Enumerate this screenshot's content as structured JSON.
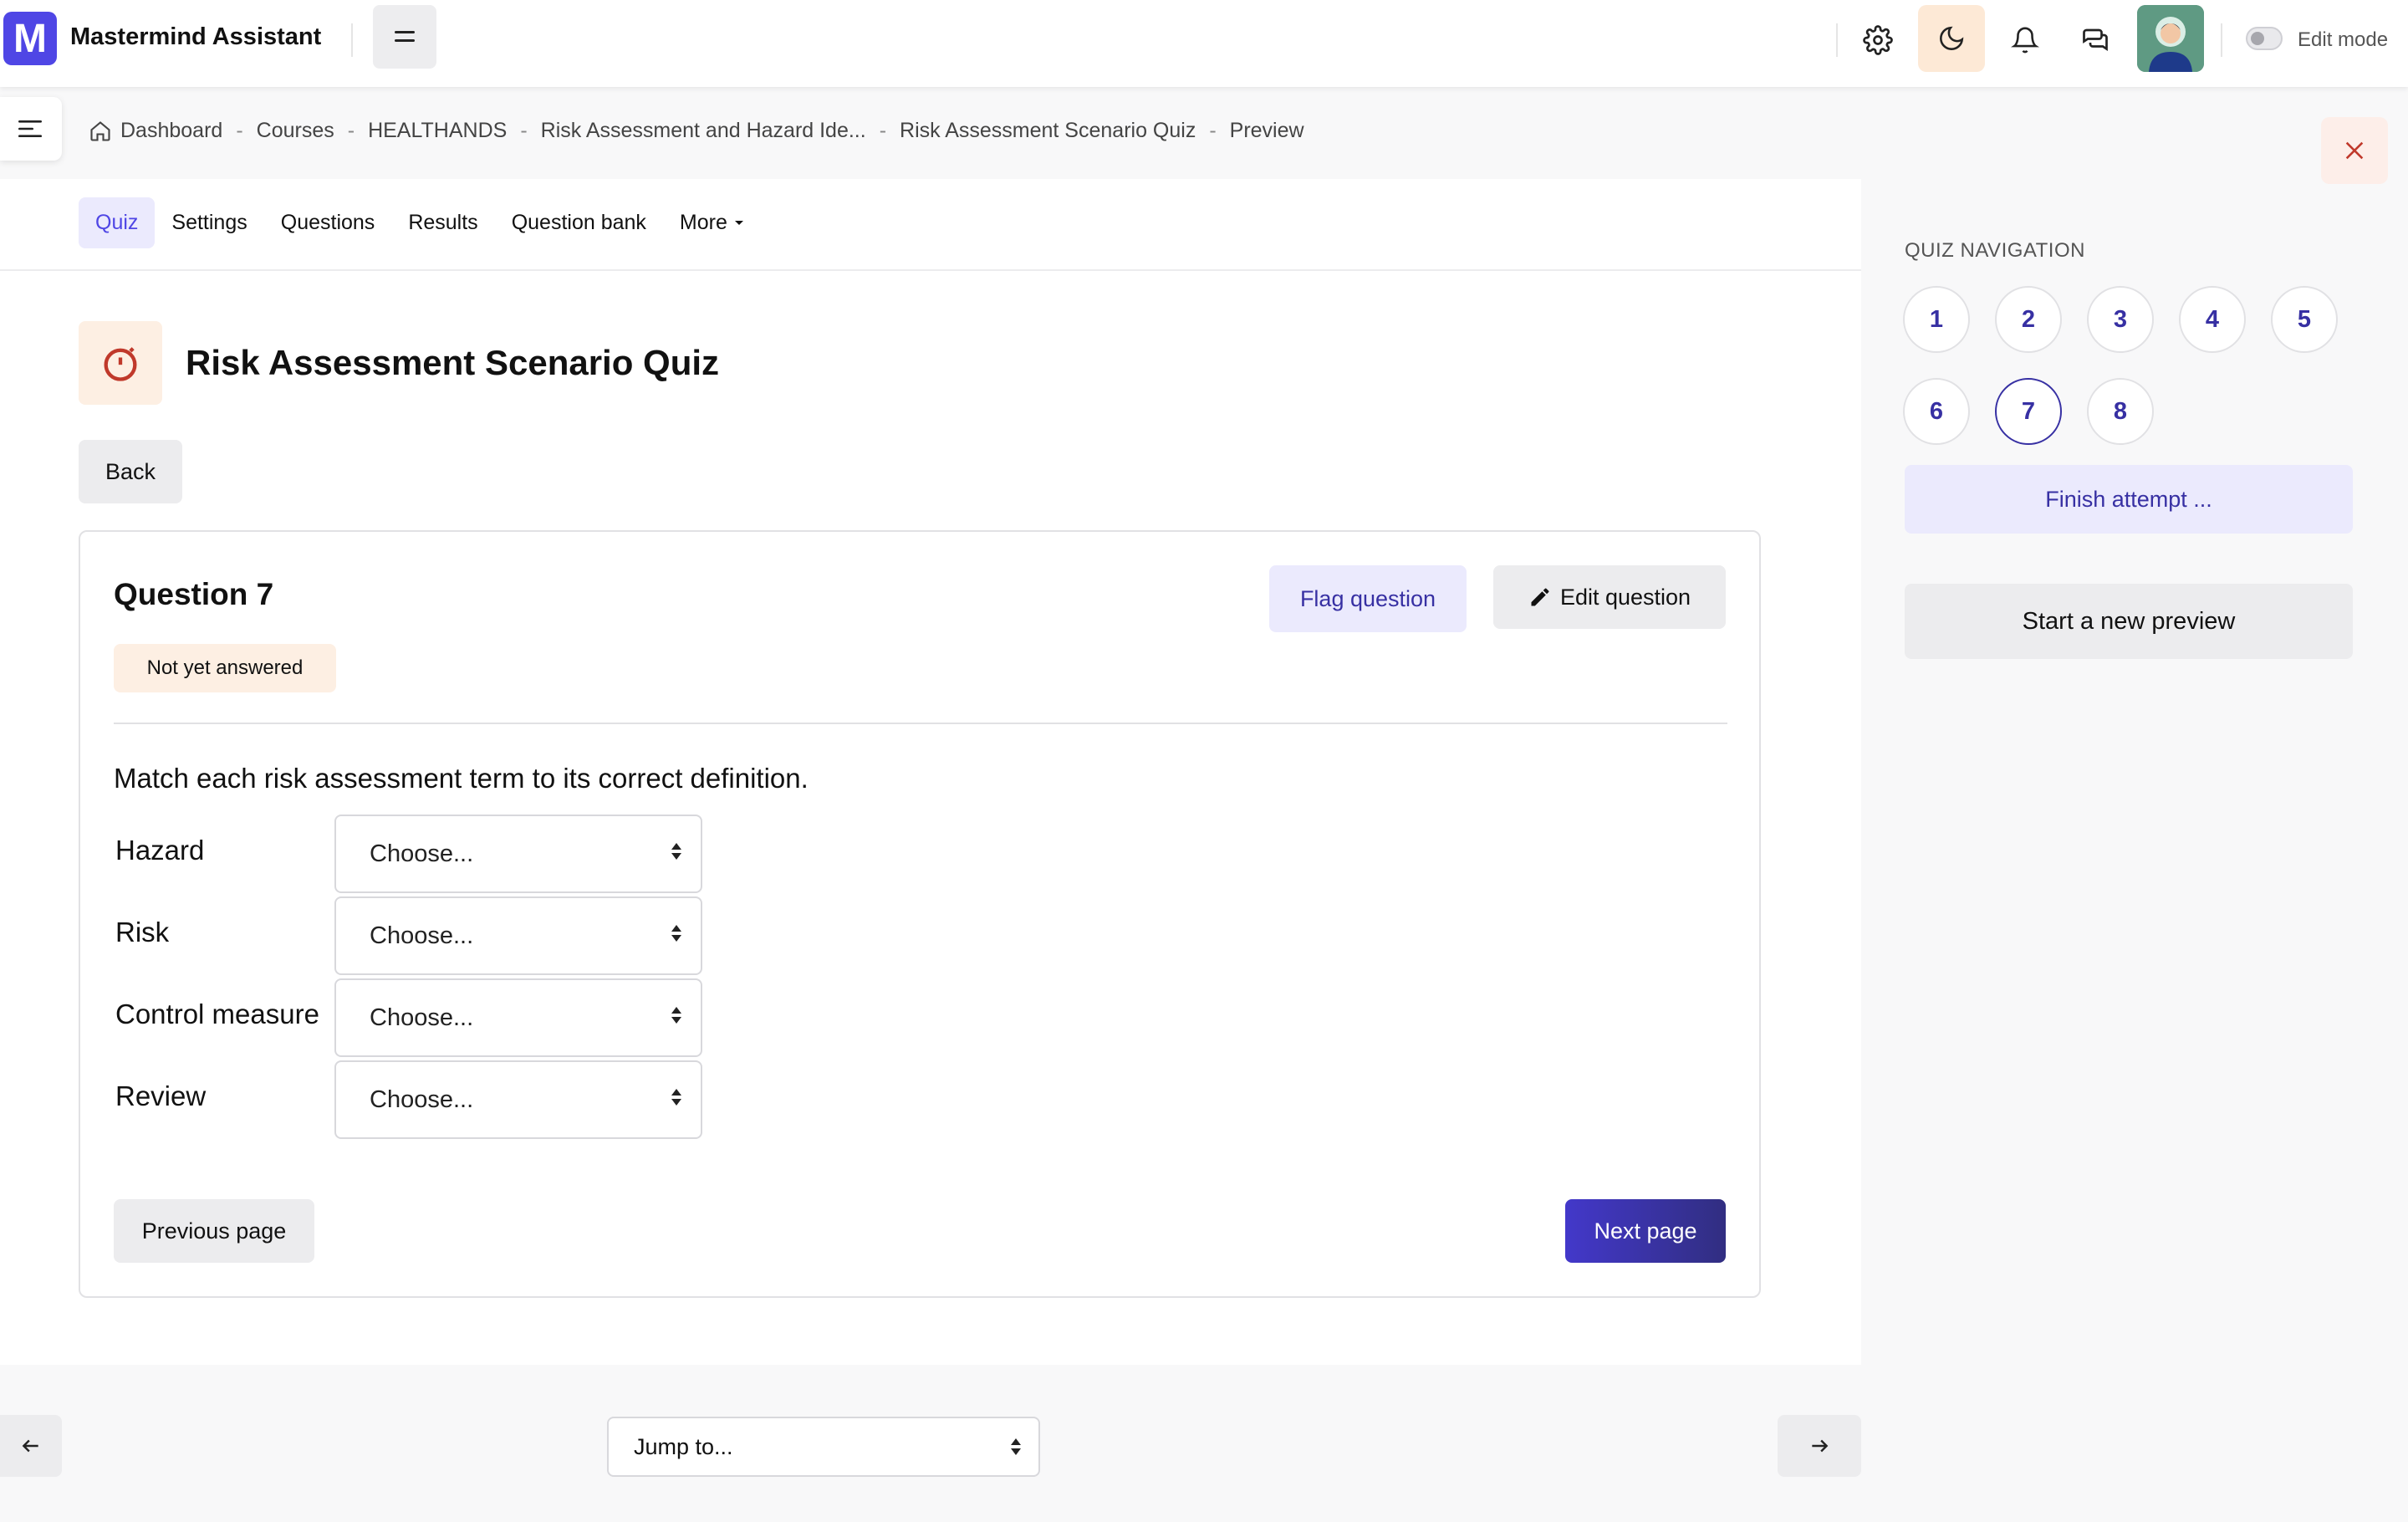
{
  "header": {
    "app_title": "Mastermind Assistant",
    "logo_letter": "M",
    "edit_mode_label": "Edit mode"
  },
  "breadcrumb": [
    "Dashboard",
    "Courses",
    "HEALTHANDS",
    "Risk Assessment and Hazard Ide...",
    "Risk Assessment Scenario Quiz",
    "Preview"
  ],
  "tabs": [
    "Quiz",
    "Settings",
    "Questions",
    "Results",
    "Question bank",
    "More"
  ],
  "active_tab": "Quiz",
  "quiz": {
    "title": "Risk Assessment Scenario Quiz",
    "back_label": "Back"
  },
  "question": {
    "title": "Question 7",
    "status": "Not yet answered",
    "flag_label": "Flag question",
    "edit_label": "Edit question",
    "text": "Match each risk assessment term to its correct definition.",
    "matches": [
      {
        "label": "Hazard",
        "selected": "Choose..."
      },
      {
        "label": "Risk",
        "selected": "Choose..."
      },
      {
        "label": "Control measure",
        "selected": "Choose..."
      },
      {
        "label": "Review",
        "selected": "Choose..."
      }
    ],
    "prev_label": "Previous page",
    "next_label": "Next page"
  },
  "bottom_nav": {
    "jump_label": "Jump to..."
  },
  "sidebar": {
    "heading": "QUIZ NAVIGATION",
    "numbers": [
      "1",
      "2",
      "3",
      "4",
      "5",
      "6",
      "7",
      "8"
    ],
    "current": "7",
    "finish_label": "Finish attempt ...",
    "new_preview_label": "Start a new preview"
  },
  "colors": {
    "accent": "#4f46e5",
    "accent_dark": "#3730a3",
    "status_bg": "#fdefe3"
  }
}
